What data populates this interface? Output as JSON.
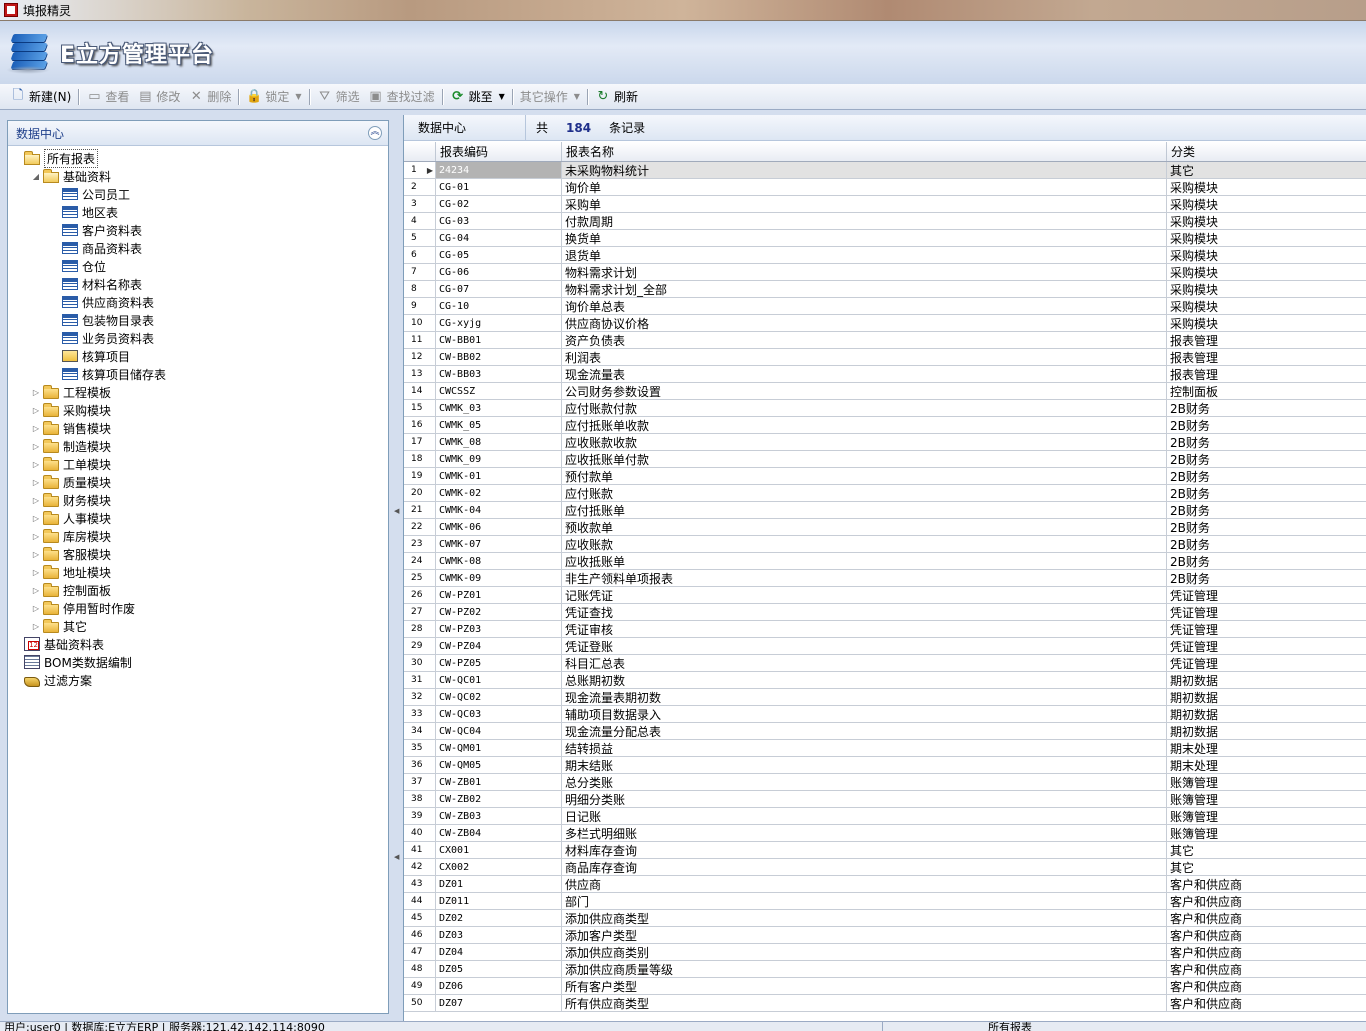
{
  "window": {
    "title": "填报精灵"
  },
  "banner": {
    "brand": "E立方管理平台"
  },
  "toolbar": {
    "buttons": [
      {
        "label": "新建(N)",
        "icon": "new-document-icon",
        "enabled": true
      },
      {
        "label": "查看",
        "icon": "view-icon",
        "enabled": false
      },
      {
        "label": "修改",
        "icon": "edit-icon",
        "enabled": false
      },
      {
        "label": "删除",
        "icon": "delete-icon",
        "enabled": false
      },
      {
        "label": "锁定",
        "icon": "lock-icon",
        "enabled": false,
        "dropdown": true
      },
      {
        "label": "筛选",
        "icon": "filter-icon",
        "enabled": false
      },
      {
        "label": "查找过滤",
        "icon": "find-filter-icon",
        "enabled": false
      },
      {
        "label": "跳至",
        "icon": "jump-icon",
        "enabled": true,
        "dropdown": true
      },
      {
        "label": "其它操作",
        "icon": "",
        "enabled": false,
        "dropdown": true
      },
      {
        "label": "刷新",
        "icon": "refresh-icon",
        "enabled": true
      }
    ]
  },
  "left_panel": {
    "title": "数据中心",
    "tree": [
      {
        "label": "所有报表",
        "level": 0,
        "icon": "folder-open",
        "expander": "",
        "selected": true
      },
      {
        "label": "基础资料",
        "level": 1,
        "icon": "folder-open",
        "expander": "◢"
      },
      {
        "label": "公司员工",
        "level": 2,
        "icon": "table"
      },
      {
        "label": "地区表",
        "level": 2,
        "icon": "table"
      },
      {
        "label": "客户资料表",
        "level": 2,
        "icon": "table"
      },
      {
        "label": "商品资料表",
        "level": 2,
        "icon": "table"
      },
      {
        "label": "仓位",
        "level": 2,
        "icon": "table"
      },
      {
        "label": "材料名称表",
        "level": 2,
        "icon": "table"
      },
      {
        "label": "供应商资料表",
        "level": 2,
        "icon": "table"
      },
      {
        "label": "包装物目录表",
        "level": 2,
        "icon": "table"
      },
      {
        "label": "业务员资料表",
        "level": 2,
        "icon": "table"
      },
      {
        "label": "核算项目",
        "level": 2,
        "icon": "calc"
      },
      {
        "label": "核算项目储存表",
        "level": 2,
        "icon": "table"
      },
      {
        "label": "工程模板",
        "level": 1,
        "icon": "folder",
        "expander": "▷"
      },
      {
        "label": "采购模块",
        "level": 1,
        "icon": "folder",
        "expander": "▷"
      },
      {
        "label": "销售模块",
        "level": 1,
        "icon": "folder",
        "expander": "▷"
      },
      {
        "label": "制造模块",
        "level": 1,
        "icon": "folder",
        "expander": "▷"
      },
      {
        "label": "工单模块",
        "level": 1,
        "icon": "folder",
        "expander": "▷"
      },
      {
        "label": "质量模块",
        "level": 1,
        "icon": "folder",
        "expander": "▷"
      },
      {
        "label": "财务模块",
        "level": 1,
        "icon": "folder",
        "expander": "▷"
      },
      {
        "label": "人事模块",
        "level": 1,
        "icon": "folder",
        "expander": "▷"
      },
      {
        "label": "库房模块",
        "level": 1,
        "icon": "folder",
        "expander": "▷"
      },
      {
        "label": "客服模块",
        "level": 1,
        "icon": "folder",
        "expander": "▷"
      },
      {
        "label": "地址模块",
        "level": 1,
        "icon": "folder",
        "expander": "▷"
      },
      {
        "label": "控制面板",
        "level": 1,
        "icon": "folder",
        "expander": "▷"
      },
      {
        "label": "停用暂时作废",
        "level": 1,
        "icon": "folder",
        "expander": "▷"
      },
      {
        "label": "其它",
        "level": 1,
        "icon": "folder",
        "expander": "▷"
      },
      {
        "label": "基础资料表",
        "level": 0,
        "icon": "report",
        "expander": ""
      },
      {
        "label": "BOM类数据编制",
        "level": 0,
        "icon": "bom",
        "expander": ""
      },
      {
        "label": "过滤方案",
        "level": 0,
        "icon": "filter",
        "expander": ""
      }
    ]
  },
  "summary": {
    "crumb": "数据中心",
    "prefix": "共",
    "count": "184",
    "suffix": "条记录"
  },
  "grid": {
    "columns": [
      "报表编码",
      "报表名称",
      "分类"
    ],
    "rows": [
      [
        "1",
        "24234",
        "未采购物料统计",
        "其它"
      ],
      [
        "2",
        "CG-01",
        "询价单",
        "采购模块"
      ],
      [
        "3",
        "CG-02",
        "采购单",
        "采购模块"
      ],
      [
        "4",
        "CG-03",
        "付款周期",
        "采购模块"
      ],
      [
        "5",
        "CG-04",
        "换货单",
        "采购模块"
      ],
      [
        "6",
        "CG-05",
        "退货单",
        "采购模块"
      ],
      [
        "7",
        "CG-06",
        "物料需求计划",
        "采购模块"
      ],
      [
        "8",
        "CG-07",
        "物料需求计划_全部",
        "采购模块"
      ],
      [
        "9",
        "CG-10",
        "询价单总表",
        "采购模块"
      ],
      [
        "10",
        "CG-xyjg",
        "供应商协议价格",
        "采购模块"
      ],
      [
        "11",
        "CW-BB01",
        "资产负债表",
        "报表管理"
      ],
      [
        "12",
        "CW-BB02",
        "利润表",
        "报表管理"
      ],
      [
        "13",
        "CW-BB03",
        "现金流量表",
        "报表管理"
      ],
      [
        "14",
        "CWCSSZ",
        "公司财务参数设置",
        "控制面板"
      ],
      [
        "15",
        "CWMK_03",
        "应付账款付款",
        "2B财务"
      ],
      [
        "16",
        "CWMK_05",
        "应付抵账单收款",
        "2B财务"
      ],
      [
        "17",
        "CWMK_08",
        "应收账款收款",
        "2B财务"
      ],
      [
        "18",
        "CWMK_09",
        "应收抵账单付款",
        "2B财务"
      ],
      [
        "19",
        "CWMK-01",
        "预付款单",
        "2B财务"
      ],
      [
        "20",
        "CWMK-02",
        "应付账款",
        "2B财务"
      ],
      [
        "21",
        "CWMK-04",
        "应付抵账单",
        "2B财务"
      ],
      [
        "22",
        "CWMK-06",
        "预收款单",
        "2B财务"
      ],
      [
        "23",
        "CWMK-07",
        "应收账款",
        "2B财务"
      ],
      [
        "24",
        "CWMK-08",
        "应收抵账单",
        "2B财务"
      ],
      [
        "25",
        "CWMK-09",
        "非生产领料单项报表",
        "2B财务"
      ],
      [
        "26",
        "CW-PZ01",
        "记账凭证",
        "凭证管理"
      ],
      [
        "27",
        "CW-PZ02",
        "凭证查找",
        "凭证管理"
      ],
      [
        "28",
        "CW-PZ03",
        "凭证审核",
        "凭证管理"
      ],
      [
        "29",
        "CW-PZ04",
        "凭证登账",
        "凭证管理"
      ],
      [
        "30",
        "CW-PZ05",
        "科目汇总表",
        "凭证管理"
      ],
      [
        "31",
        "CW-QC01",
        "总账期初数",
        "期初数据"
      ],
      [
        "32",
        "CW-QC02",
        "现金流量表期初数",
        "期初数据"
      ],
      [
        "33",
        "CW-QC03",
        "辅助项目数据录入",
        "期初数据"
      ],
      [
        "34",
        "CW-QC04",
        "现金流量分配总表",
        "期初数据"
      ],
      [
        "35",
        "CW-QM01",
        "结转损益",
        "期末处理"
      ],
      [
        "36",
        "CW-QM05",
        "期末结账",
        "期末处理"
      ],
      [
        "37",
        "CW-ZB01",
        "总分类账",
        "账簿管理"
      ],
      [
        "38",
        "CW-ZB02",
        "明细分类账",
        "账簿管理"
      ],
      [
        "39",
        "CW-ZB03",
        "日记账",
        "账簿管理"
      ],
      [
        "40",
        "CW-ZB04",
        "多栏式明细账",
        "账簿管理"
      ],
      [
        "41",
        "CX001",
        "材料库存查询",
        "其它"
      ],
      [
        "42",
        "CX002",
        "商品库存查询",
        "其它"
      ],
      [
        "43",
        "DZ01",
        "供应商",
        "客户和供应商"
      ],
      [
        "44",
        "DZ011",
        "部门",
        "客户和供应商"
      ],
      [
        "45",
        "DZ02",
        "添加供应商类型",
        "客户和供应商"
      ],
      [
        "46",
        "DZ03",
        "添加客户类型",
        "客户和供应商"
      ],
      [
        "47",
        "DZ04",
        "添加供应商类别",
        "客户和供应商"
      ],
      [
        "48",
        "DZ05",
        "添加供应商质量等级",
        "客户和供应商"
      ],
      [
        "49",
        "DZ06",
        "所有客户类型",
        "客户和供应商"
      ],
      [
        "50",
        "DZ07",
        "所有供应商类型",
        "客户和供应商"
      ]
    ]
  },
  "statusbar": {
    "left": "用户:user0 | 数据库:E立方ERP | 服务器:121.42.142.114:8090",
    "right": "所有报表"
  }
}
